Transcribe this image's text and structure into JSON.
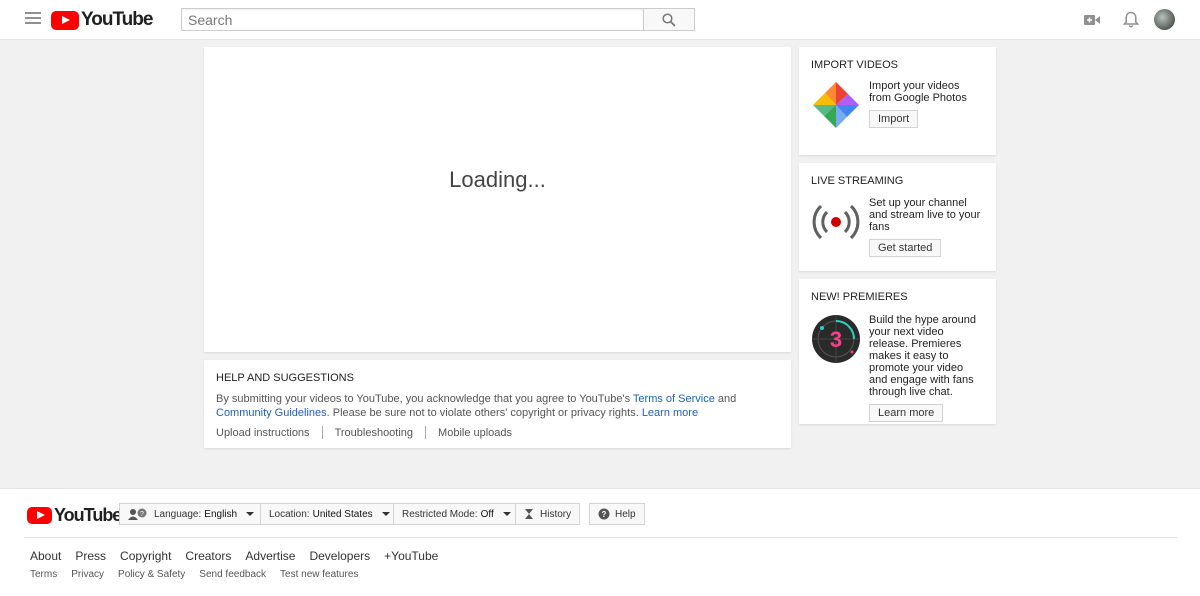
{
  "header": {
    "logo_text": "YouTube",
    "search_placeholder": "Search"
  },
  "upload": {
    "status": "Loading..."
  },
  "help": {
    "title": "HELP AND SUGGESTIONS",
    "text_part1": "By submitting your videos to YouTube, you acknowledge that you agree to YouTube's ",
    "terms_link": "Terms of Service",
    "text_and": " and ",
    "guidelines_link": "Community Guidelines",
    "text_part2": ". Please be sure not to violate others' copyright or privacy rights. ",
    "learn_more": "Learn more",
    "links": [
      "Upload instructions",
      "Troubleshooting",
      "Mobile uploads"
    ]
  },
  "sidebar": {
    "import": {
      "title": "IMPORT VIDEOS",
      "text": "Import your videos from Google Photos",
      "button": "Import"
    },
    "live": {
      "title": "LIVE STREAMING",
      "text": "Set up your channel and stream live to your fans",
      "button": "Get started"
    },
    "premieres": {
      "title": "NEW! PREMIERES",
      "text": "Build the hype around your next video release. Premieres makes it easy to promote your video and engage with fans through live chat.",
      "button": "Learn more",
      "badge_number": "3"
    }
  },
  "footer": {
    "logo_text": "YouTube",
    "language_label": "Language:",
    "language_value": "English",
    "location_label": "Location:",
    "location_value": "United States",
    "restricted_label": "Restricted Mode:",
    "restricted_value": "Off",
    "history": "History",
    "help": "Help",
    "primary_links": [
      "About",
      "Press",
      "Copyright",
      "Creators",
      "Advertise",
      "Developers",
      "+YouTube"
    ],
    "secondary_links": [
      "Terms",
      "Privacy",
      "Policy & Safety",
      "Send feedback",
      "Test new features"
    ]
  },
  "colors": {
    "brand_red": "#ff0000",
    "link_blue": "#1c62b9",
    "background": "#f1f1f1"
  }
}
